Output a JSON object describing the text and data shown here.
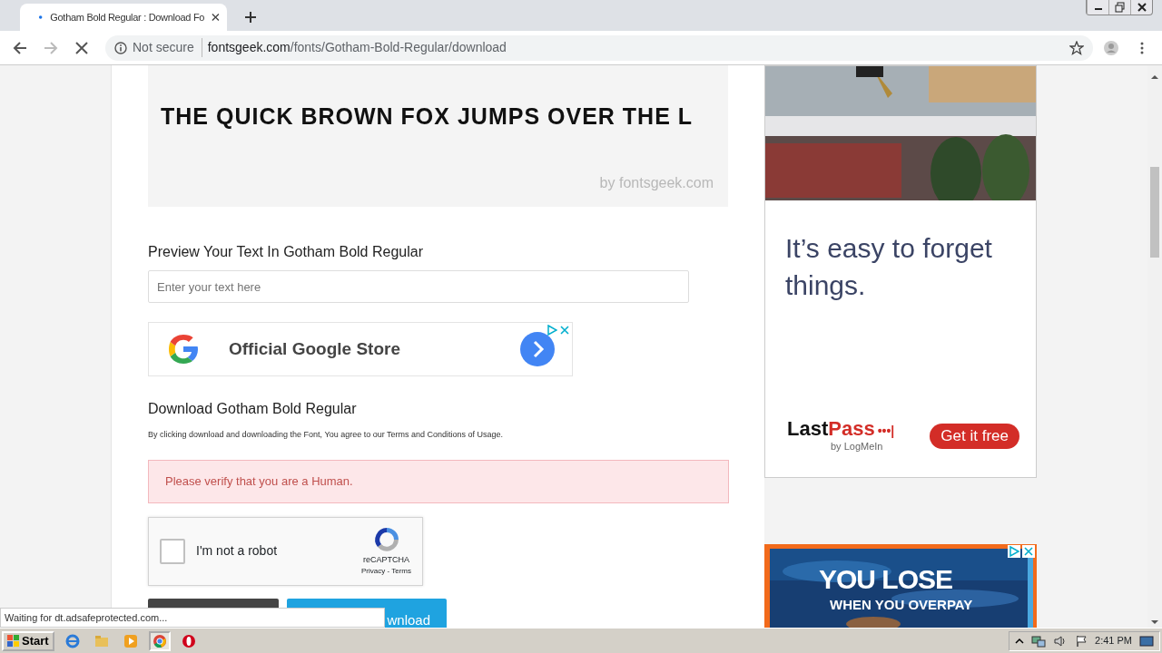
{
  "browser": {
    "tab": {
      "title": "Gotham Bold Regular : Download Fo",
      "selected": true
    },
    "security": "Not secure",
    "url_host": "fontsgeek.com",
    "url_path": "/fonts/Gotham-Bold-Regular/download",
    "loading": true
  },
  "sample": {
    "text": "THE QUICK BROWN FOX JUMPS OVER THE L",
    "watermark": "by fontsgeek.com"
  },
  "preview": {
    "heading": "Preview Your Text In Gotham Bold Regular",
    "placeholder": "Enter your text here"
  },
  "ad_banner": {
    "text": "Official Google Store"
  },
  "download": {
    "heading": "Download Gotham Bold Regular",
    "terms": "By clicking download and downloading the Font, You agree to our Terms and Conditions of Usage.",
    "alert": "Please verify that you are a Human.",
    "captcha": {
      "label": "I'm not a robot",
      "checked": false,
      "brand": "reCAPTCHA",
      "links": "Privacy - Terms"
    },
    "buttons": [
      {
        "kind": "zip"
      },
      {
        "kind": "direct",
        "label": "wnload"
      }
    ]
  },
  "side_ad": {
    "headline": "It’s easy to forget things.",
    "brand_parts": [
      "Last",
      "Pass"
    ],
    "brand_dots": "•••|",
    "byline": "by LogMeIn",
    "cta": "Get it free"
  },
  "bottom_ad": {
    "title": "YOU LOSE",
    "subtitle": "WHEN YOU OVERPAY"
  },
  "status_bubble": "Waiting for dt.adsafeprotected.com...",
  "taskbar": {
    "start": "Start",
    "apps": [
      {
        "kind": "ie",
        "selected": false
      },
      {
        "kind": "folder",
        "selected": false
      },
      {
        "kind": "media",
        "selected": false
      },
      {
        "kind": "chrome",
        "selected": true
      },
      {
        "kind": "opera",
        "selected": false
      }
    ],
    "clock": "2:41 PM"
  }
}
